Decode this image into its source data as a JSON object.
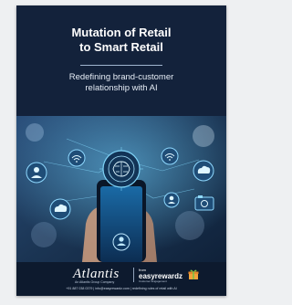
{
  "cover": {
    "title_line1": "Mutation of Retail",
    "title_line2": "to Smart Retail",
    "subtitle_line1": "Redefining brand-customer",
    "subtitle_line2": "relationship with AI"
  },
  "footer": {
    "atlantis_logo": "Atlantis",
    "atlantis_tagline": "An Atlantis Group Company",
    "easyrewardz_small": "from",
    "easyrewardz_logo": "easyrewardz",
    "easyrewardz_tagline": "Customer Engagement",
    "contact_line": "+91 887 038 0379 | info@easyrewardz.com | redefining rules of retail with AI"
  },
  "colors": {
    "background": "#0f1d33",
    "accent_cyan": "#53c6f0",
    "accent_orange": "#f2a23a",
    "accent_green": "#7bc043"
  },
  "icons": [
    "chip-brain-icon",
    "wifi-icon",
    "cloud-icon",
    "user-icon",
    "camera-icon",
    "person-location-icon",
    "smartphone-icon",
    "gift-icon"
  ]
}
